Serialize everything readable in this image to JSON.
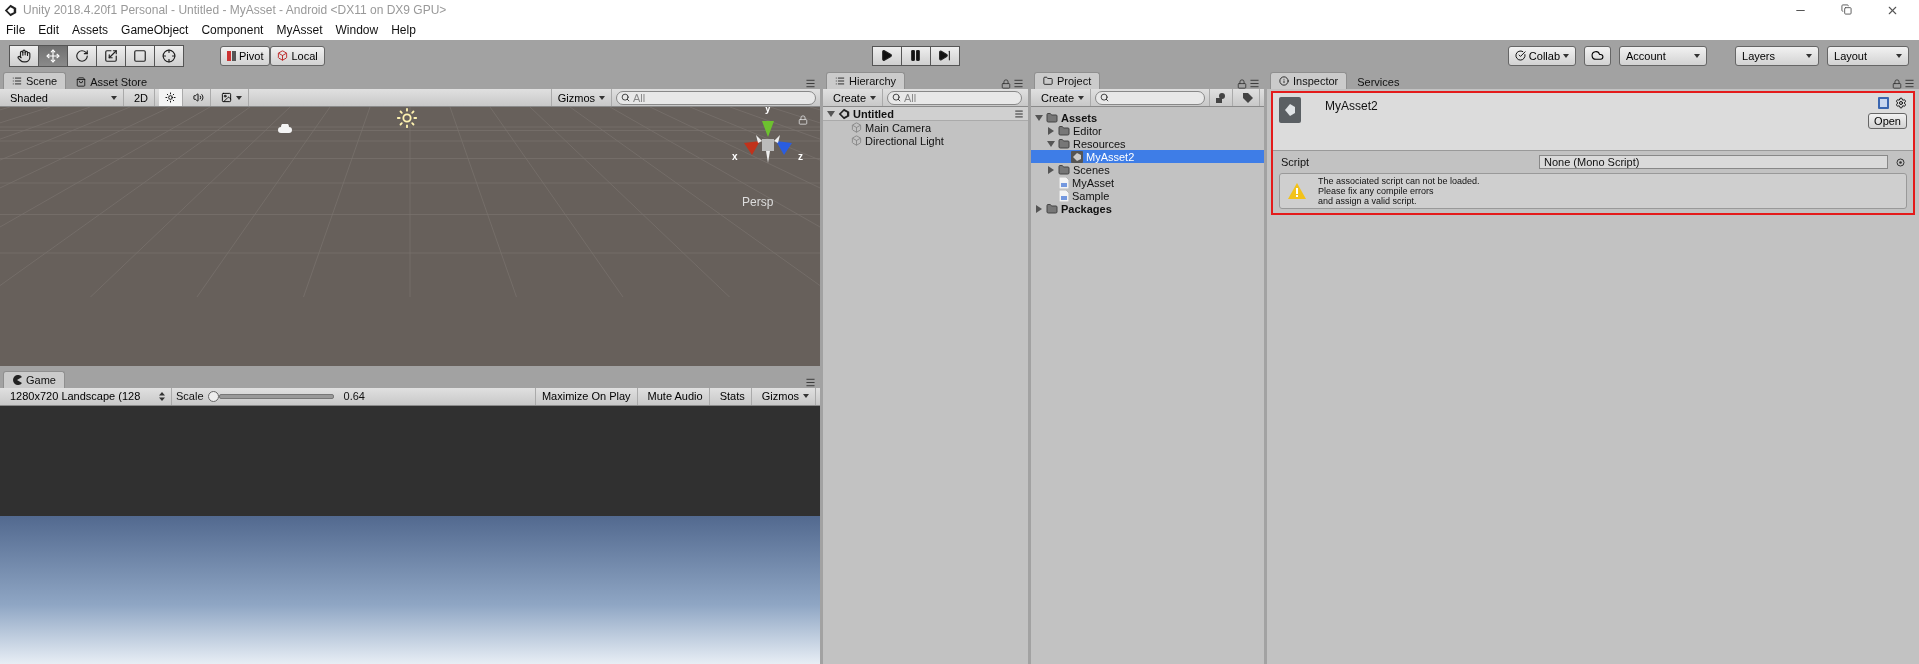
{
  "window": {
    "title": "Unity 2018.4.20f1 Personal - Untitled - MyAsset - Android <DX11 on DX9 GPU>"
  },
  "menu": [
    "File",
    "Edit",
    "Assets",
    "GameObject",
    "Component",
    "MyAsset",
    "Window",
    "Help"
  ],
  "toolbar": {
    "tools": [
      {
        "kind": "hand",
        "selected": false
      },
      {
        "kind": "move",
        "selected": true
      },
      {
        "kind": "rotate",
        "selected": false
      },
      {
        "kind": "scale",
        "selected": false
      },
      {
        "kind": "rect",
        "selected": false
      },
      {
        "kind": "transform",
        "selected": false
      }
    ],
    "pivot": "Pivot",
    "local": "Local",
    "playback": [
      {
        "kind": "play"
      },
      {
        "kind": "pause"
      },
      {
        "kind": "step"
      }
    ],
    "collab": "Collab",
    "account": "Account",
    "layers": "Layers",
    "layout": "Layout"
  },
  "scene": {
    "tabs": [
      {
        "label": "Scene",
        "selected": true
      },
      {
        "label": "Asset Store",
        "selected": false
      }
    ],
    "shading": "Shaded",
    "mode_2d": "2D",
    "gizmos": "Gizmos",
    "search": {
      "placeholder": "All"
    },
    "axes": [
      "y",
      "x",
      "z"
    ],
    "view": "Persp"
  },
  "game": {
    "tab": "Game",
    "resolution": "1280x720 Landscape (128",
    "scale_label": "Scale",
    "scale": {
      "level": 0
    },
    "scale_value": "0.64",
    "buttons": [
      "Maximize On Play",
      "Mute Audio",
      "Stats"
    ],
    "gizmos": "Gizmos"
  },
  "hierarchy": {
    "tab": "Hierarchy",
    "create": "Create",
    "search": {
      "placeholder": "All"
    },
    "scene": "Untitled",
    "items": [
      "Main Camera",
      "Directional Light"
    ]
  },
  "project": {
    "tab": "Project",
    "create": "Create",
    "tree": [
      {
        "label": "Assets",
        "kind": "folder",
        "expanded": true,
        "selected": false,
        "children": [
          {
            "label": "Editor",
            "kind": "folder",
            "expanded": false,
            "selected": false
          },
          {
            "label": "Resources",
            "kind": "folder",
            "expanded": true,
            "selected": false,
            "children": [
              {
                "label": "MyAsset2",
                "kind": "asset",
                "selected": true
              }
            ]
          },
          {
            "label": "Scenes",
            "kind": "folder",
            "expanded": false,
            "selected": false
          },
          {
            "label": "MyAsset",
            "kind": "script",
            "selected": false
          },
          {
            "label": "Sample",
            "kind": "script",
            "selected": false
          }
        ]
      },
      {
        "label": "Packages",
        "kind": "folder",
        "expanded": false,
        "selected": false
      }
    ]
  },
  "inspector": {
    "tabs": [
      {
        "label": "Inspector",
        "selected": true
      },
      {
        "label": "Services",
        "selected": false
      }
    ],
    "asset_name": "MyAsset2",
    "open_button": "Open",
    "script_label": "Script",
    "script_value": "None (Mono Script)",
    "warning": [
      "The associated script can not be loaded.",
      "Please fix any compile errors",
      "and assign a valid script."
    ]
  }
}
